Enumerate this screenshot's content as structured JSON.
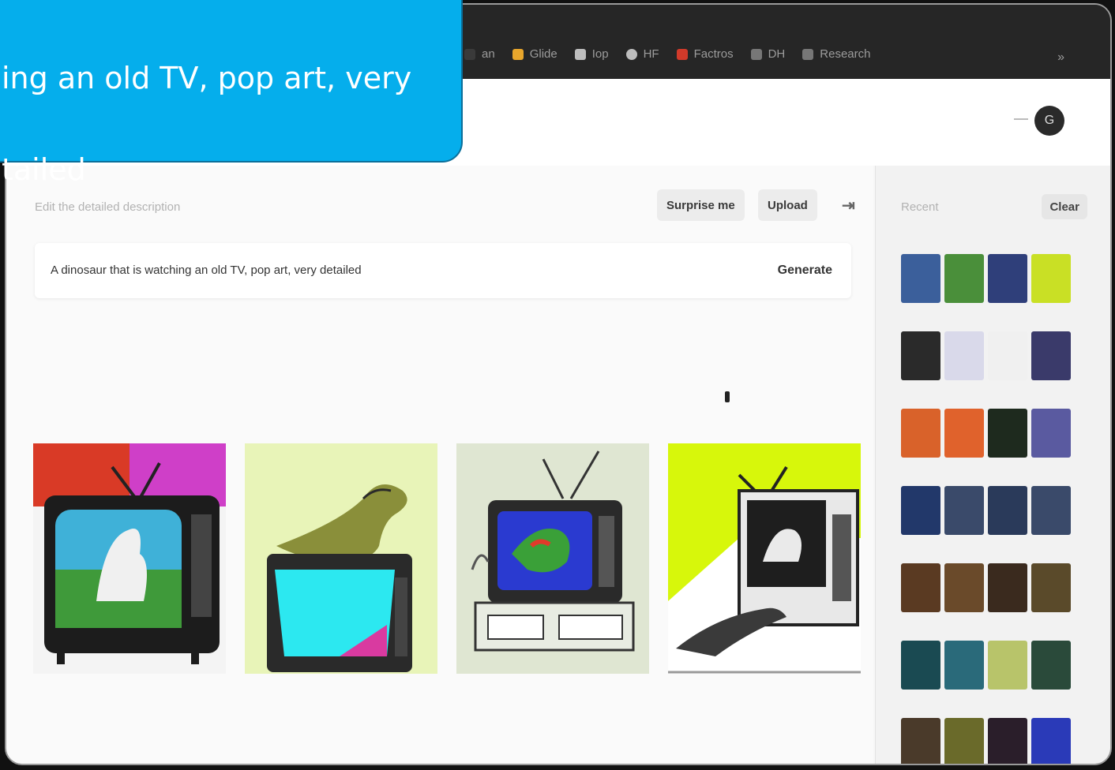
{
  "bookmarks": [
    {
      "label": "an",
      "color": "#3a3a3a"
    },
    {
      "label": "Glide",
      "color": "#e8a62c"
    },
    {
      "label": "Iop",
      "color": "#bdbdbd"
    },
    {
      "label": "HF",
      "color": "#bdbdbd"
    },
    {
      "label": "Factros",
      "color": "#d23a2a"
    },
    {
      "label": "DH",
      "color": "#777777"
    },
    {
      "label": "Research",
      "color": "#777777"
    }
  ],
  "bookmarks_more": "»",
  "avatar_letter": "G",
  "main": {
    "hint": "Edit the detailed description",
    "surprise_label": "Surprise me",
    "upload_label": "Upload",
    "more_label": "⇥",
    "prompt": "A dinosaur that is watching an old TV, pop art, very detailed",
    "generate_label": "Generate"
  },
  "sidebar": {
    "recent_label": "Recent",
    "clear_label": "Clear"
  },
  "callout": {
    "line1": "ing an old TV,  pop art, very",
    "line2": "tailed"
  },
  "results": [
    {
      "name": "result-1",
      "bg": "#d93a26"
    },
    {
      "name": "result-2",
      "bg": "#e8f4b8"
    },
    {
      "name": "result-3",
      "bg": "#dfe6d2"
    },
    {
      "name": "result-4",
      "bg": "#d7f70b"
    }
  ],
  "history_colors": [
    "#3b5f9b",
    "#4a8f3a",
    "#2f3f7a",
    "#c9e025",
    "#2a2a2a",
    "#d9d9ea",
    "#f0f0f0",
    "#3a3a6a",
    "#d9622a",
    "#e0622c",
    "#1e2a1e",
    "#5a5aa0",
    "#22386a",
    "#3a4a6a",
    "#2a3a5a",
    "#3a4a6a",
    "#5a3a22",
    "#6a4a2a",
    "#3a2a1e",
    "#5a4a2a",
    "#1a4a52",
    "#2a6a7a",
    "#b8c46a",
    "#2a4a3a",
    "#4a3a2a",
    "#6a6a2a",
    "#2a1e2a",
    "#2a3ab8"
  ]
}
